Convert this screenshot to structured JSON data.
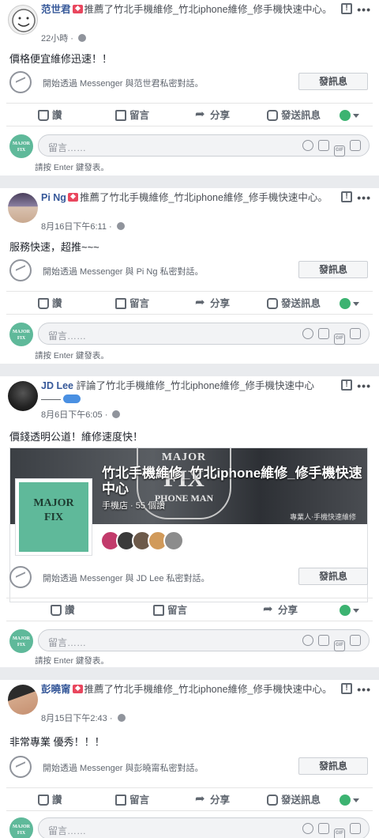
{
  "posts": [
    {
      "name": "范世君",
      "action": "推薦了",
      "page": "竹北手機維修_竹北iphone維修_修手機快速中心",
      "suffix": "。",
      "time": "22小時",
      "text": "價格便宜維修迅速！！",
      "messenger_text": "開始透過 Messenger 與范世君私密對話。",
      "has_message_action": true
    },
    {
      "name": "Pi Ng",
      "action": "推薦了",
      "page": "竹北手機維修_竹北iphone維修_修手機快速中心",
      "suffix": "。",
      "time": "8月16日下午6:11",
      "text": "服務快速，超推~~~",
      "messenger_text": "開始透過 Messenger 與 Pi Ng 私密對話。",
      "has_message_action": true
    },
    {
      "name": "JD Lee",
      "action": "評論了",
      "page": "竹北手機維修_竹北iphone維修_修手機快速中心",
      "suffix": "——",
      "time": "8月6日下午6:05",
      "text": "價錢透明公道！維修速度快！",
      "messenger_text": "開始透過 Messenger 與 JD Lee 私密對話。",
      "has_message_action": false
    },
    {
      "name": "彭曉甯",
      "action": "推薦了",
      "page": "竹北手機維修_竹北iphone維修_修手機快速中心",
      "suffix": "。",
      "time": "8月15日下午2:43",
      "text": "非常專業 優秀！！！",
      "messenger_text": "開始透過 Messenger 與彭曉甯私密對話。",
      "has_message_action": true
    }
  ],
  "labels": {
    "send_message_btn": "發訊息",
    "like": "讚",
    "comment": "留言",
    "share": "分享",
    "send_message": "發送訊息",
    "comment_placeholder": "留言……",
    "enter_hint": "請按 Enter 鍵發表。",
    "report": "!",
    "more": "•••",
    "comment_avatar_line1": "MAJOR",
    "comment_avatar_line2": "FIX"
  },
  "page_card": {
    "title": "竹北手機維修_竹北iphone維修_修手機快速中心",
    "subtitle": "手機店 · 55 個讚",
    "cover_logo_line1": "MAJOR",
    "cover_logo_line2": "FIX",
    "cover_logo_line3": "PHONE MAN",
    "cover_note": "專業人‧手機快速維修",
    "profile_line1": "MAJOR",
    "profile_line2": "FIX"
  },
  "colors": {
    "link": "#365899",
    "brand_green": "#5fb99a",
    "recommend_red": "#e9475e"
  }
}
